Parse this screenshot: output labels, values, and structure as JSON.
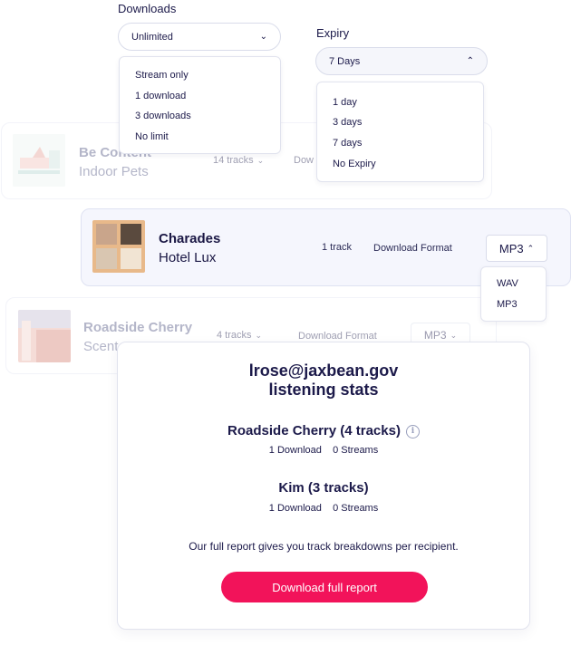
{
  "downloads": {
    "label": "Downloads",
    "selected": "Unlimited",
    "options": [
      "Stream only",
      "1 download",
      "3 downloads",
      "No limit"
    ]
  },
  "expiry": {
    "label": "Expiry",
    "selected": "7 Days",
    "options": [
      "1 day",
      "3 days",
      "7 days",
      "No Expiry"
    ]
  },
  "tracks": [
    {
      "title": "Be Content",
      "artist": "Indoor Pets",
      "count": "14 tracks",
      "format_label": "Dow"
    },
    {
      "title": "Charades",
      "artist": "Hotel Lux",
      "count": "1 track",
      "format_label": "Download Format",
      "format_value": "MP3",
      "format_options": [
        "WAV",
        "MP3"
      ]
    },
    {
      "title": "Roadside Cherry",
      "artist": "Scent",
      "count": "4 tracks",
      "format_label": "Download Format",
      "format_value": "MP3"
    }
  ],
  "stats": {
    "email": "lrose@jaxbean.gov",
    "subtitle": "listening stats",
    "items": [
      {
        "title": "Roadside Cherry (4 tracks)",
        "downloads": "1 Download",
        "streams": "0 Streams"
      },
      {
        "title": "Kim (3 tracks)",
        "downloads": "1 Download",
        "streams": "0 Streams"
      }
    ],
    "report_text": "Our full report gives you track breakdowns per recipient.",
    "cta_label": "Download full report"
  },
  "colors": {
    "accent": "#f2135a",
    "text": "#1c1a4a"
  }
}
